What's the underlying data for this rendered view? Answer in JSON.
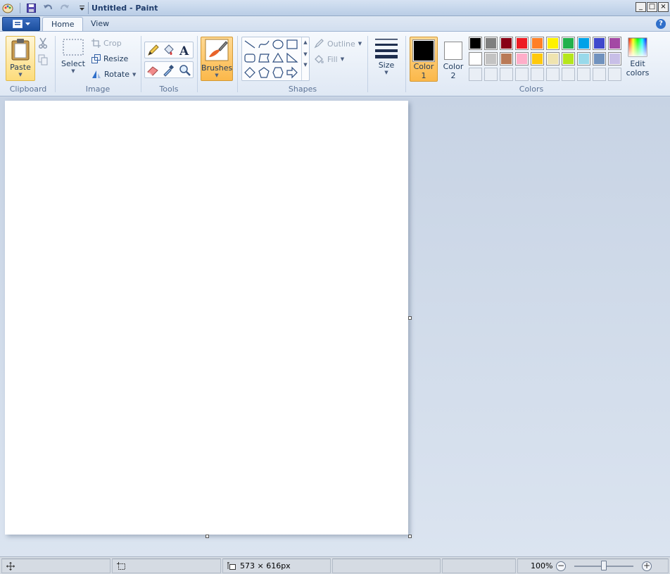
{
  "window": {
    "title": "Untitled - Paint",
    "controls": {
      "minimize": "_",
      "maximize": "□",
      "close": "×"
    }
  },
  "tabs": [
    {
      "label": "Home",
      "active": true
    },
    {
      "label": "View",
      "active": false
    }
  ],
  "help_label": "?",
  "ribbon": {
    "clipboard": {
      "label": "Clipboard",
      "paste": "Paste"
    },
    "image": {
      "label": "Image",
      "select": "Select",
      "crop": "Crop",
      "resize": "Resize",
      "rotate": "Rotate"
    },
    "tools": {
      "label": "Tools"
    },
    "brushes": {
      "label": "Brushes"
    },
    "shapes": {
      "label": "Shapes",
      "outline": "Outline",
      "fill": "Fill"
    },
    "size": {
      "label": "Size"
    },
    "colors": {
      "label": "Colors",
      "color1": "Color",
      "color1_num": "1",
      "color2": "Color",
      "color2_num": "2",
      "edit1": "Edit",
      "edit2": "colors",
      "color1_value": "#000000",
      "color2_value": "#ffffff",
      "palette_row1": [
        "#000000",
        "#7f7f7f",
        "#880015",
        "#ed1c24",
        "#ff7f27",
        "#fff200",
        "#22b14c",
        "#00a2e8",
        "#3f48cc",
        "#a349a4"
      ],
      "palette_row2": [
        "#ffffff",
        "#c3c3c3",
        "#b97a57",
        "#ffaec9",
        "#ffc90e",
        "#efe4b0",
        "#b5e61d",
        "#99d9ea",
        "#7092be",
        "#c8bfe7"
      ]
    }
  },
  "status": {
    "canvas_size": "573 × 616px",
    "zoom": "100%"
  }
}
